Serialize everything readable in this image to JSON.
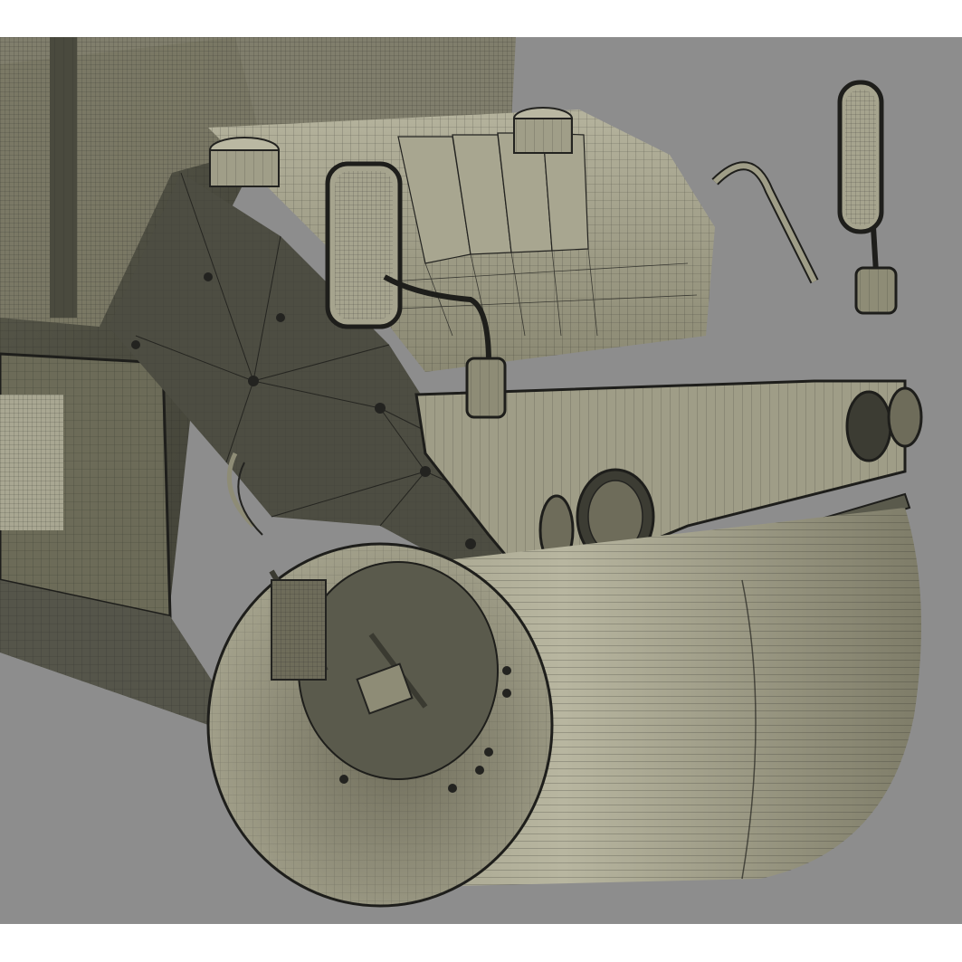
{
  "scene": {
    "background_color": "#8d8d8d",
    "frame_color": "#ffffff",
    "mesh_fill_color": "#8e8c76",
    "mesh_light_color": "#b4b29c",
    "mesh_dark_color": "#4a4a3e",
    "wire_color": "#232320",
    "shading": "wireframe-on-shaded",
    "icons": [
      "viewport-icon"
    ]
  }
}
